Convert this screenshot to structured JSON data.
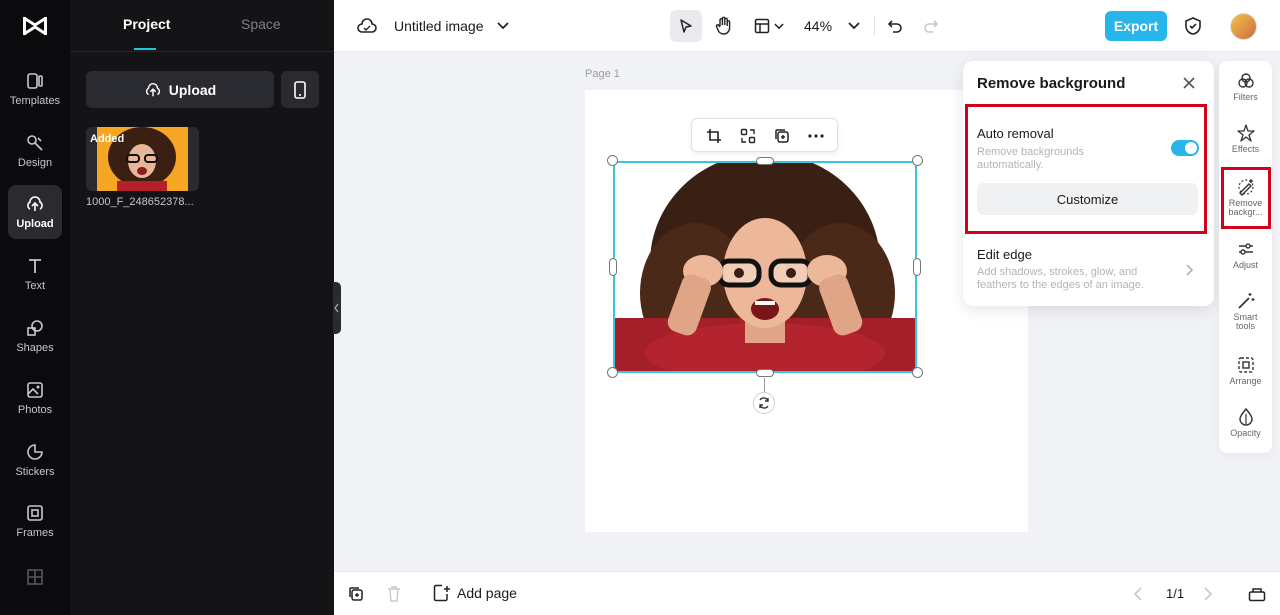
{
  "left_rail": {
    "items": [
      {
        "label": "Templates",
        "icon": "templates-icon"
      },
      {
        "label": "Design",
        "icon": "design-icon"
      },
      {
        "label": "Upload",
        "icon": "upload-icon",
        "active": true
      },
      {
        "label": "Text",
        "icon": "text-icon"
      },
      {
        "label": "Shapes",
        "icon": "shapes-icon"
      },
      {
        "label": "Photos",
        "icon": "photos-icon"
      },
      {
        "label": "Stickers",
        "icon": "stickers-icon"
      },
      {
        "label": "Frames",
        "icon": "frames-icon"
      }
    ]
  },
  "panel": {
    "tabs": [
      {
        "label": "Project",
        "active": true
      },
      {
        "label": "Space",
        "active": false
      }
    ],
    "upload_label": "Upload",
    "media": [
      {
        "badge": "Added",
        "name": "1000_F_248652378..."
      }
    ]
  },
  "topbar": {
    "title": "Untitled image",
    "zoom": "44%",
    "export_label": "Export"
  },
  "canvas": {
    "page_label": "Page 1"
  },
  "remove_bg": {
    "title": "Remove background",
    "auto_title": "Auto removal",
    "auto_desc": "Remove backgrounds automatically.",
    "auto_enabled": true,
    "customize_label": "Customize",
    "edge_title": "Edit edge",
    "edge_desc": "Add shadows, strokes, glow, and feathers to the edges of an image."
  },
  "right_tools": [
    {
      "label": "Filters"
    },
    {
      "label": "Effects"
    },
    {
      "label": "Remove backgr..."
    },
    {
      "label": "Adjust"
    },
    {
      "label": "Smart tools"
    },
    {
      "label": "Arrange"
    },
    {
      "label": "Opacity"
    }
  ],
  "bottombar": {
    "add_page_label": "Add page",
    "page_indicator": "1/1"
  },
  "colors": {
    "accent": "#26b6ea",
    "selection": "#38c6dd",
    "highlight": "#d0021b"
  }
}
